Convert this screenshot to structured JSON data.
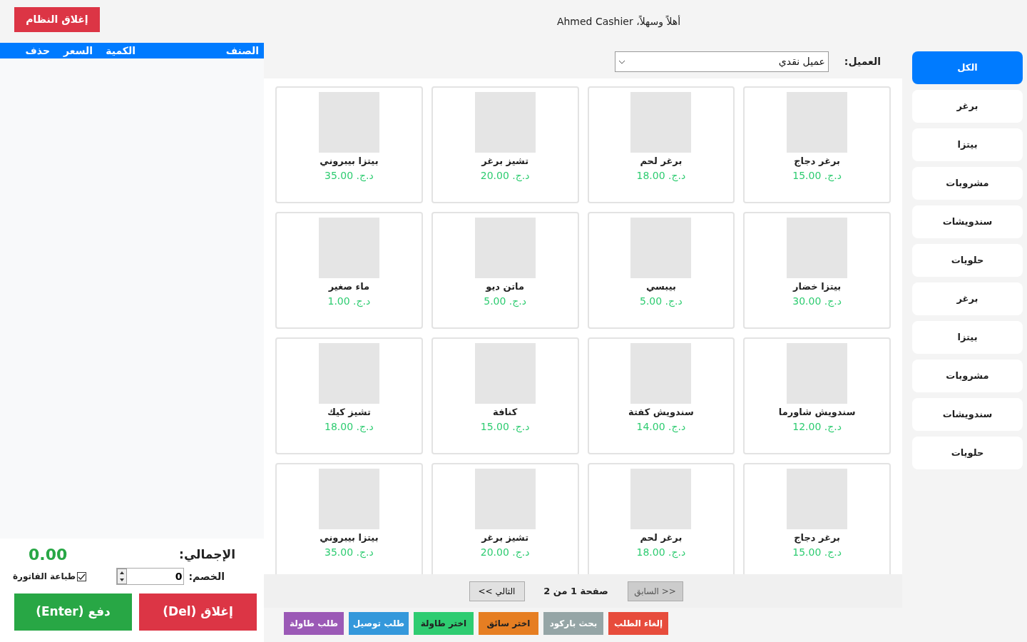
{
  "header": {
    "close_system": "إغلاق النظام",
    "greeting": "أهلاً وسهلاً، Ahmed Cashier"
  },
  "cart": {
    "columns": [
      "الصنف",
      "الكمية",
      "السعر",
      "حذف"
    ],
    "total_label": "الإجمالي:",
    "total": "0.00",
    "discount_label": "الخصم:",
    "discount": "0",
    "print_invoice": {
      "label": "طباعة الفاتورة",
      "checked": true
    },
    "buttons": [
      {
        "label": "إغلاق (Del)",
        "kind": "close"
      },
      {
        "label": "دفع (Enter)",
        "kind": "pay"
      }
    ]
  },
  "customer": {
    "label": "العميل:",
    "value": "عميل نقدي"
  },
  "categories": [
    {
      "label": "الكل",
      "selected": true
    },
    {
      "label": "برغر",
      "selected": false
    },
    {
      "label": "بيتزا",
      "selected": false
    },
    {
      "label": "مشروبات",
      "selected": false
    },
    {
      "label": "سندويشات",
      "selected": false
    },
    {
      "label": "حلويات",
      "selected": false
    },
    {
      "label": "برغر",
      "selected": false
    },
    {
      "label": "بيتزا",
      "selected": false
    },
    {
      "label": "مشروبات",
      "selected": false
    },
    {
      "label": "سندويشات",
      "selected": false
    },
    {
      "label": "حلويات",
      "selected": false
    }
  ],
  "products": [
    {
      "name": "برغر دجاج",
      "price": "د.ج. 15.00"
    },
    {
      "name": "برغر لحم",
      "price": "د.ج. 18.00"
    },
    {
      "name": "تشيز برغر",
      "price": "د.ج. 20.00"
    },
    {
      "name": "بيتزا بيبروني",
      "price": "د.ج. 35.00"
    },
    {
      "name": "بيتزا خضار",
      "price": "د.ج. 30.00"
    },
    {
      "name": "بيبسي",
      "price": "د.ج. 5.00"
    },
    {
      "name": "ماتن ديو",
      "price": "د.ج. 5.00"
    },
    {
      "name": "ماء صغير",
      "price": "د.ج. 1.00"
    },
    {
      "name": "سندويش شاورما",
      "price": "د.ج. 12.00"
    },
    {
      "name": "سندويش كفتة",
      "price": "د.ج. 14.00"
    },
    {
      "name": "كنافة",
      "price": "د.ج. 15.00"
    },
    {
      "name": "تشيز كيك",
      "price": "د.ج. 18.00"
    },
    {
      "name": "برغر دجاج",
      "price": "د.ج. 15.00"
    },
    {
      "name": "برغر لحم",
      "price": "د.ج. 18.00"
    },
    {
      "name": "تشيز برغر",
      "price": "د.ج. 20.00"
    },
    {
      "name": "بيتزا بيبروني",
      "price": "د.ج. 35.00"
    }
  ],
  "pagination": {
    "previous": {
      "label": "<< السابق",
      "disabled": true
    },
    "page": "صفحة 1 من 2",
    "next": {
      "label": "التالي >>",
      "disabled": false
    }
  },
  "actions": [
    {
      "label": "إلغاء الطلب",
      "color": "#e74c3c",
      "dark_text": false
    },
    {
      "label": "بحث باركود",
      "color": "#95a5a6",
      "dark_text": false
    },
    {
      "label": "اختر سائق",
      "color": "#e67e22",
      "dark_text": true
    },
    {
      "label": "اختر طاولة",
      "color": "#2ecc71",
      "dark_text": true
    },
    {
      "label": "طلب توصيل",
      "color": "#3498db",
      "dark_text": false
    },
    {
      "label": "طلب طاولة",
      "color": "#9b59b6",
      "dark_text": false
    }
  ]
}
